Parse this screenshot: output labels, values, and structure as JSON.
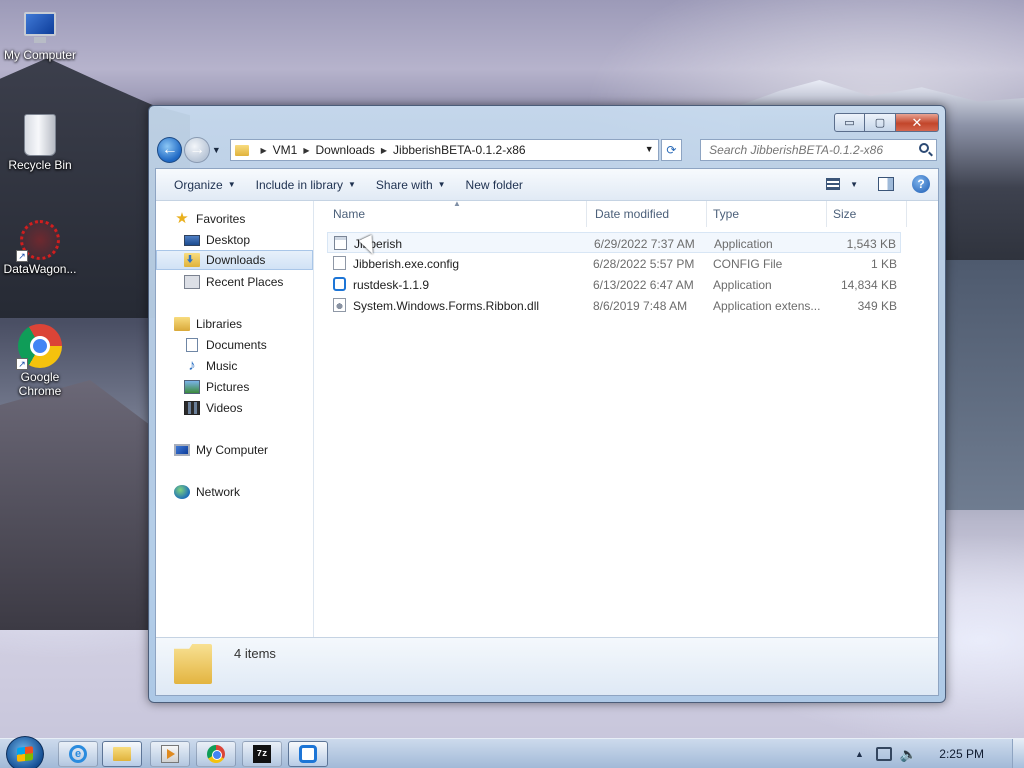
{
  "desktop": {
    "icons": [
      {
        "label": "My Computer",
        "icon": "computer-icon"
      },
      {
        "label": "Recycle Bin",
        "icon": "recycle-bin-icon"
      },
      {
        "label": "DataWagon...",
        "icon": "datawagon-icon"
      },
      {
        "label": "Google Chrome",
        "icon": "chrome-icon"
      }
    ]
  },
  "window": {
    "controls": {
      "minimize": "▭",
      "maximize": "▢",
      "close": "✕"
    },
    "address": {
      "crumbs": [
        "VM1",
        "Downloads",
        "JibberishBETA-0.1.2-x86"
      ]
    },
    "search": {
      "placeholder": "Search JibberishBETA-0.1.2-x86"
    },
    "toolbar": {
      "organize": "Organize",
      "include_in_library": "Include in library",
      "share_with": "Share with",
      "new_folder": "New folder"
    },
    "nav_pane": {
      "favorites_header": "Favorites",
      "favorites": [
        "Desktop",
        "Downloads",
        "Recent Places"
      ],
      "selected": "Downloads",
      "libraries_header": "Libraries",
      "libraries": [
        "Documents",
        "Music",
        "Pictures",
        "Videos"
      ],
      "my_computer": "My Computer",
      "network": "Network"
    },
    "columns": {
      "name": "Name",
      "date": "Date modified",
      "type": "Type",
      "size": "Size"
    },
    "files": [
      {
        "name": "Jibberish",
        "date": "6/29/2022 7:37 AM",
        "type": "Application",
        "size": "1,543 KB",
        "icon": "application-icon"
      },
      {
        "name": "Jibberish.exe.config",
        "date": "6/28/2022 5:57 PM",
        "type": "CONFIG File",
        "size": "1 KB",
        "icon": "config-file-icon"
      },
      {
        "name": "rustdesk-1.1.9",
        "date": "6/13/2022 6:47 AM",
        "type": "Application",
        "size": "14,834 KB",
        "icon": "rustdesk-icon"
      },
      {
        "name": "System.Windows.Forms.Ribbon.dll",
        "date": "8/6/2019 7:48 AM",
        "type": "Application extens...",
        "size": "349 KB",
        "icon": "dll-file-icon"
      }
    ],
    "details": {
      "item_count": "4 items"
    }
  },
  "taskbar": {
    "pinned": [
      "internet-explorer-icon",
      "explorer-folder-icon",
      "media-player-icon",
      "chrome-icon",
      "7zip-icon",
      "rustdesk-icon"
    ],
    "seven_zip_label": "7z",
    "ie_label": "e",
    "clock": "2:25 PM"
  }
}
